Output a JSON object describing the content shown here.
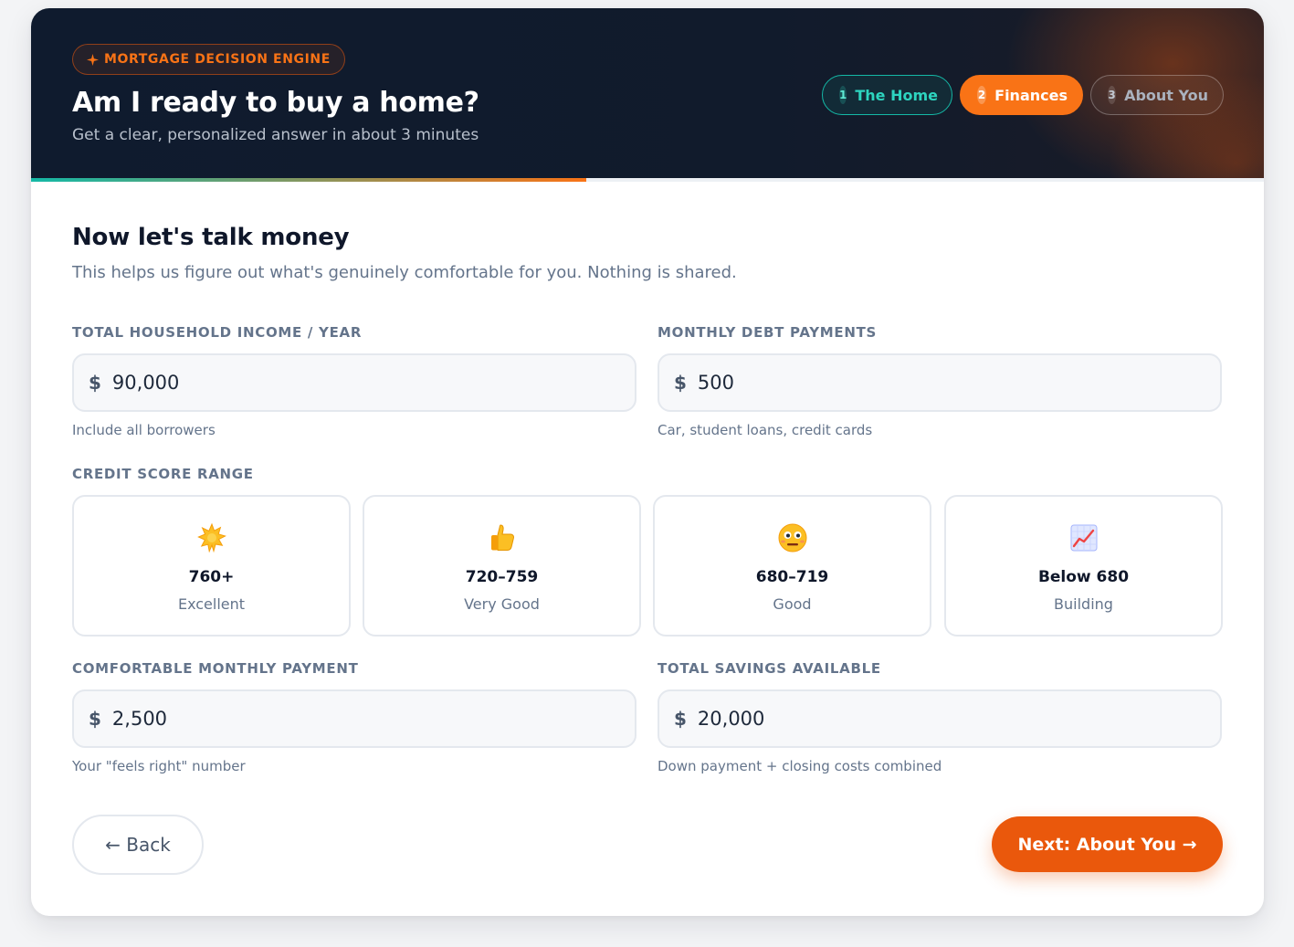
{
  "header": {
    "badge_icon": "sparkle-icon",
    "badge": "MORTGAGE DECISION ENGINE",
    "title": "Am I ready to buy a home?",
    "subtitle": "Get a clear, personalized answer in about 3 minutes"
  },
  "steps": [
    {
      "number": "1",
      "label": "The Home",
      "state": "completed"
    },
    {
      "number": "2",
      "label": "Finances",
      "state": "active"
    },
    {
      "number": "3",
      "label": "About You",
      "state": "upcoming"
    }
  ],
  "progress": {
    "percent": 45
  },
  "section": {
    "title": "Now let's talk money",
    "subtitle": "This helps us figure out what's genuinely comfortable for you. Nothing is shared."
  },
  "fields": {
    "income": {
      "label": "TOTAL HOUSEHOLD INCOME / YEAR",
      "currency": "$",
      "value": "90,000",
      "hint": "Include all borrowers"
    },
    "debt": {
      "label": "MONTHLY DEBT PAYMENTS",
      "currency": "$",
      "value": "500",
      "hint": "Car, student loans, credit cards"
    },
    "payment": {
      "label": "COMFORTABLE MONTHLY PAYMENT",
      "currency": "$",
      "value": "2,500",
      "hint": "Your \"feels right\" number"
    },
    "savings": {
      "label": "TOTAL SAVINGS AVAILABLE",
      "currency": "$",
      "value": "20,000",
      "hint": "Down payment + closing costs combined"
    }
  },
  "credit": {
    "label": "CREDIT SCORE RANGE",
    "options": [
      {
        "icon": "sparkle-star-icon",
        "range": "760+",
        "tier": "Excellent"
      },
      {
        "icon": "thumbs-up-icon",
        "range": "720–759",
        "tier": "Very Good"
      },
      {
        "icon": "neutral-face-icon",
        "range": "680–719",
        "tier": "Good"
      },
      {
        "icon": "chart-increasing-icon",
        "range": "Below 680",
        "tier": "Building"
      }
    ]
  },
  "nav": {
    "back_label": "← Back",
    "next_label": "Next: About You →"
  },
  "colors": {
    "accent": "#ea580c",
    "teal": "#14b8a6",
    "navy": "#0f1b2e"
  }
}
